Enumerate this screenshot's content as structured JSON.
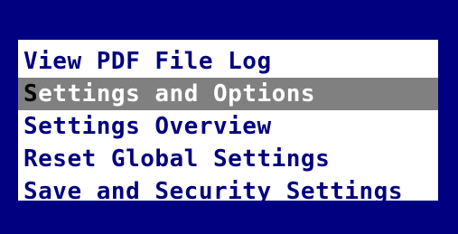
{
  "colors": {
    "background": "#000080",
    "menu_background": "#ffffff",
    "item_text": "#000080",
    "selected_background": "#808080",
    "selected_text": "#ffffff"
  },
  "menu": {
    "items": [
      {
        "label": "View PDF File Log"
      },
      {
        "hotkey": "S",
        "rest": "ettings and Options",
        "selected": true
      },
      {
        "label": "Settings Overview"
      },
      {
        "label": "Reset Global Settings"
      },
      {
        "label": "Save and Security Settings"
      }
    ]
  }
}
